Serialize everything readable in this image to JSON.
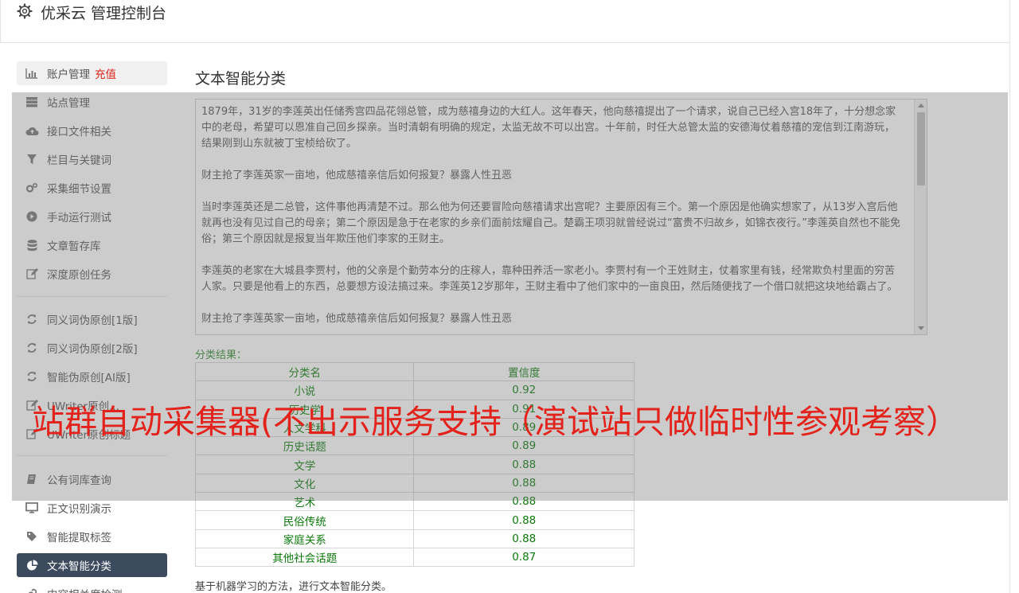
{
  "header": {
    "title": "优采云 管理控制台"
  },
  "sidebar": {
    "items": [
      {
        "label": "账户管理",
        "extra": "充值",
        "icon": "bar-chart-icon"
      },
      {
        "label": "站点管理",
        "icon": "server-icon"
      },
      {
        "label": "接口文件相关",
        "icon": "cloud-upload-icon"
      },
      {
        "label": "栏目与关键词",
        "icon": "filter-icon"
      },
      {
        "label": "采集细节设置",
        "icon": "gears-icon"
      },
      {
        "label": "手动运行测试",
        "icon": "play-circle-icon"
      },
      {
        "label": "文章暂存库",
        "icon": "database-icon"
      },
      {
        "label": "深度原创任务",
        "icon": "edit-icon"
      },
      {
        "label": "同义词伪原创[1版]",
        "icon": "refresh-icon"
      },
      {
        "label": "同义词伪原创[2版]",
        "icon": "refresh-icon"
      },
      {
        "label": "智能伪原创[AI版]",
        "icon": "refresh-icon"
      },
      {
        "label": "UWriter原创...",
        "icon": "edit-icon"
      },
      {
        "label": "UWriter原创标题",
        "icon": "edit-icon"
      },
      {
        "label": "公有词库查询",
        "icon": "book-icon"
      },
      {
        "label": "正文识别演示",
        "icon": "monitor-icon"
      },
      {
        "label": "智能提取标签",
        "icon": "tag-icon"
      },
      {
        "label": "文本智能分类",
        "icon": "pie-chart-icon"
      },
      {
        "label": "内容相关度检测",
        "icon": "link-icon"
      }
    ]
  },
  "main": {
    "title": "文本智能分类",
    "text_paragraphs": [
      "1879年，31岁的李莲英出任储秀宫四品花翎总管，成为慈禧身边的大红人。这年春天，他向慈禧提出了一个请求，说自己已经入宫18年了，十分想念家中的老母，希望可以恩准自己回乡探亲。当时清朝有明确的规定，太监无故不可以出宫。十年前，时任大总管太监的安德海仗着慈禧的宠信到江南游玩，结果刚到山东就被丁宝桢给砍了。",
      "财主抢了李莲英家一亩地，他成慈禧亲信后如何报复？暴露人性丑恶",
      "当时李莲英还是二总管，这件事他再清楚不过。那么他为何还要冒险向慈禧请求出宫呢？主要原因有三个。第一个原因是他确实想家了，从13岁入宫后他就再也没有见过自己的母亲；第二个原因是急于在老家的乡亲们面前炫耀自己。楚霸王项羽就曾经说过“富贵不归故乡，如锦衣夜行。”李莲英自然也不能免俗；第三个原因就是报复当年欺压他们李家的王财主。",
      "李莲英的老家在大城县李贾村，他的父亲是个勤劳本分的庄稼人，靠种田养活一家老小。李贾村有一个王姓财主，仗着家里有钱，经常欺负村里面的穷苦人家。只要是他看上的东西，总要想方设法搞过来。李莲英12岁那年，王财主看中了他们家中的一亩良田，然后随便找了一个借口就把这块地给霸占了。",
      "财主抢了李莲英家一亩地，他成慈禧亲信后如何报复？暴露人性丑恶"
    ],
    "result_label": "分类结果：",
    "table": {
      "headers": [
        "分类名",
        "置信度"
      ],
      "rows": [
        [
          "小说",
          "0.92"
        ],
        [
          "历史学",
          "0.91"
        ],
        [
          "人文学科",
          "0.89"
        ],
        [
          "历史话题",
          "0.89"
        ],
        [
          "文学",
          "0.88"
        ],
        [
          "文化",
          "0.88"
        ],
        [
          "艺术",
          "0.88"
        ],
        [
          "民俗传统",
          "0.88"
        ],
        [
          "家庭关系",
          "0.88"
        ],
        [
          "其他社会话题",
          "0.87"
        ]
      ]
    },
    "description": "基于机器学习的方法，进行文本智能分类。"
  },
  "watermark": "站群自动采集器(不出示服务支持（演试站只做临时性参观考察）",
  "colors": {
    "active_bg": "#3c4a5d",
    "recharge": "#e0211b",
    "result_green": "#0a7a0a",
    "watermark": "#e3231b"
  }
}
